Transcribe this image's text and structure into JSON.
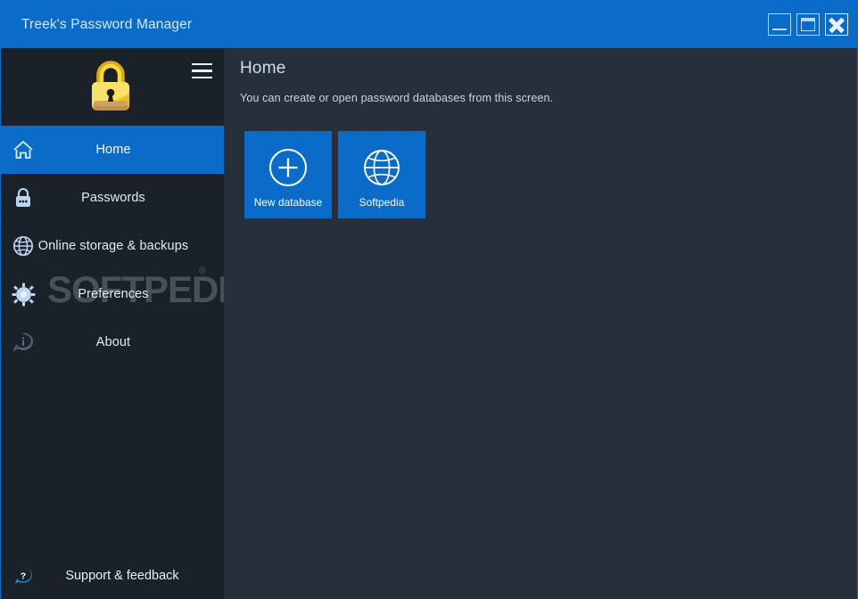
{
  "window": {
    "title": "Treek's Password Manager",
    "controls": [
      {
        "name": "minimize",
        "label": "—"
      },
      {
        "name": "maximize",
        "label": "❐"
      },
      {
        "name": "close",
        "label": "✕"
      }
    ]
  },
  "theme": {
    "accent": "#0a6cc8",
    "titlebar_bg": "#0a6cc8",
    "sidebar_bg": "#1b2128",
    "content_bg": "#27303a",
    "icon_color": "#bcd6f0",
    "text_color": "#e9f0f8",
    "logo_gold": "#f5d13b",
    "logo_shackle": "#e8b820",
    "logo_band": "#c79a52"
  },
  "sidebar": {
    "logo_icon": "padlock-logo",
    "menu_icon": "hamburger-menu-icon",
    "items": [
      {
        "label": "Home",
        "icon": "home-icon",
        "active": true
      },
      {
        "label": "Passwords",
        "icon": "lock-icon",
        "active": false
      },
      {
        "label": "Online storage & backups",
        "icon": "globe-icon",
        "active": false
      },
      {
        "label": "Preferences",
        "icon": "gear-icon",
        "active": false
      },
      {
        "label": "About",
        "icon": "info-bubble-icon",
        "active": false
      }
    ],
    "support": {
      "label": "Support & feedback",
      "icon": "question-bubble-icon"
    }
  },
  "watermark": {
    "text": "SOFTPEDIA",
    "registered": "®"
  },
  "main": {
    "title": "Home",
    "subtitle": "You can create or open password databases from this screen.",
    "tiles": [
      {
        "label": "New database",
        "icon": "plus-circle-icon"
      },
      {
        "label": "Softpedia",
        "icon": "globe-icon"
      }
    ]
  }
}
